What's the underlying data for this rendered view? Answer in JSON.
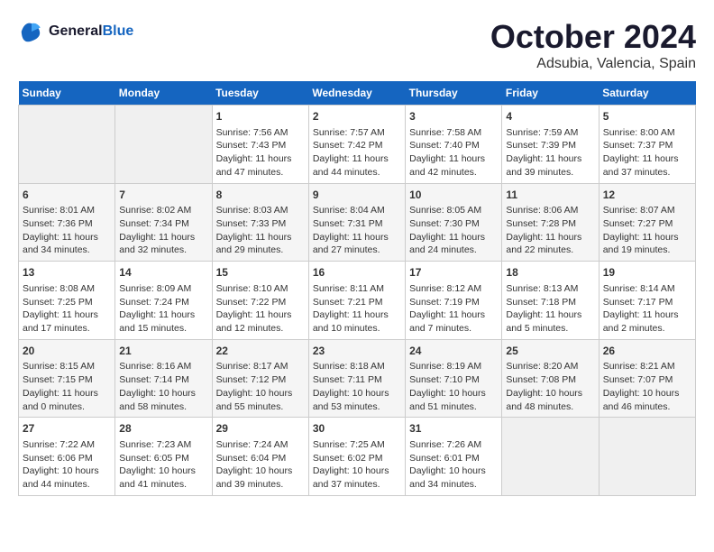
{
  "header": {
    "logo_line1": "General",
    "logo_line2": "Blue",
    "title": "October 2024",
    "subtitle": "Adsubia, Valencia, Spain"
  },
  "days_of_week": [
    "Sunday",
    "Monday",
    "Tuesday",
    "Wednesday",
    "Thursday",
    "Friday",
    "Saturday"
  ],
  "weeks": [
    [
      {
        "day": "",
        "info": ""
      },
      {
        "day": "",
        "info": ""
      },
      {
        "day": "1",
        "info": "Sunrise: 7:56 AM\nSunset: 7:43 PM\nDaylight: 11 hours and 47 minutes."
      },
      {
        "day": "2",
        "info": "Sunrise: 7:57 AM\nSunset: 7:42 PM\nDaylight: 11 hours and 44 minutes."
      },
      {
        "day": "3",
        "info": "Sunrise: 7:58 AM\nSunset: 7:40 PM\nDaylight: 11 hours and 42 minutes."
      },
      {
        "day": "4",
        "info": "Sunrise: 7:59 AM\nSunset: 7:39 PM\nDaylight: 11 hours and 39 minutes."
      },
      {
        "day": "5",
        "info": "Sunrise: 8:00 AM\nSunset: 7:37 PM\nDaylight: 11 hours and 37 minutes."
      }
    ],
    [
      {
        "day": "6",
        "info": "Sunrise: 8:01 AM\nSunset: 7:36 PM\nDaylight: 11 hours and 34 minutes."
      },
      {
        "day": "7",
        "info": "Sunrise: 8:02 AM\nSunset: 7:34 PM\nDaylight: 11 hours and 32 minutes."
      },
      {
        "day": "8",
        "info": "Sunrise: 8:03 AM\nSunset: 7:33 PM\nDaylight: 11 hours and 29 minutes."
      },
      {
        "day": "9",
        "info": "Sunrise: 8:04 AM\nSunset: 7:31 PM\nDaylight: 11 hours and 27 minutes."
      },
      {
        "day": "10",
        "info": "Sunrise: 8:05 AM\nSunset: 7:30 PM\nDaylight: 11 hours and 24 minutes."
      },
      {
        "day": "11",
        "info": "Sunrise: 8:06 AM\nSunset: 7:28 PM\nDaylight: 11 hours and 22 minutes."
      },
      {
        "day": "12",
        "info": "Sunrise: 8:07 AM\nSunset: 7:27 PM\nDaylight: 11 hours and 19 minutes."
      }
    ],
    [
      {
        "day": "13",
        "info": "Sunrise: 8:08 AM\nSunset: 7:25 PM\nDaylight: 11 hours and 17 minutes."
      },
      {
        "day": "14",
        "info": "Sunrise: 8:09 AM\nSunset: 7:24 PM\nDaylight: 11 hours and 15 minutes."
      },
      {
        "day": "15",
        "info": "Sunrise: 8:10 AM\nSunset: 7:22 PM\nDaylight: 11 hours and 12 minutes."
      },
      {
        "day": "16",
        "info": "Sunrise: 8:11 AM\nSunset: 7:21 PM\nDaylight: 11 hours and 10 minutes."
      },
      {
        "day": "17",
        "info": "Sunrise: 8:12 AM\nSunset: 7:19 PM\nDaylight: 11 hours and 7 minutes."
      },
      {
        "day": "18",
        "info": "Sunrise: 8:13 AM\nSunset: 7:18 PM\nDaylight: 11 hours and 5 minutes."
      },
      {
        "day": "19",
        "info": "Sunrise: 8:14 AM\nSunset: 7:17 PM\nDaylight: 11 hours and 2 minutes."
      }
    ],
    [
      {
        "day": "20",
        "info": "Sunrise: 8:15 AM\nSunset: 7:15 PM\nDaylight: 11 hours and 0 minutes."
      },
      {
        "day": "21",
        "info": "Sunrise: 8:16 AM\nSunset: 7:14 PM\nDaylight: 10 hours and 58 minutes."
      },
      {
        "day": "22",
        "info": "Sunrise: 8:17 AM\nSunset: 7:12 PM\nDaylight: 10 hours and 55 minutes."
      },
      {
        "day": "23",
        "info": "Sunrise: 8:18 AM\nSunset: 7:11 PM\nDaylight: 10 hours and 53 minutes."
      },
      {
        "day": "24",
        "info": "Sunrise: 8:19 AM\nSunset: 7:10 PM\nDaylight: 10 hours and 51 minutes."
      },
      {
        "day": "25",
        "info": "Sunrise: 8:20 AM\nSunset: 7:08 PM\nDaylight: 10 hours and 48 minutes."
      },
      {
        "day": "26",
        "info": "Sunrise: 8:21 AM\nSunset: 7:07 PM\nDaylight: 10 hours and 46 minutes."
      }
    ],
    [
      {
        "day": "27",
        "info": "Sunrise: 7:22 AM\nSunset: 6:06 PM\nDaylight: 10 hours and 44 minutes."
      },
      {
        "day": "28",
        "info": "Sunrise: 7:23 AM\nSunset: 6:05 PM\nDaylight: 10 hours and 41 minutes."
      },
      {
        "day": "29",
        "info": "Sunrise: 7:24 AM\nSunset: 6:04 PM\nDaylight: 10 hours and 39 minutes."
      },
      {
        "day": "30",
        "info": "Sunrise: 7:25 AM\nSunset: 6:02 PM\nDaylight: 10 hours and 37 minutes."
      },
      {
        "day": "31",
        "info": "Sunrise: 7:26 AM\nSunset: 6:01 PM\nDaylight: 10 hours and 34 minutes."
      },
      {
        "day": "",
        "info": ""
      },
      {
        "day": "",
        "info": ""
      }
    ]
  ]
}
